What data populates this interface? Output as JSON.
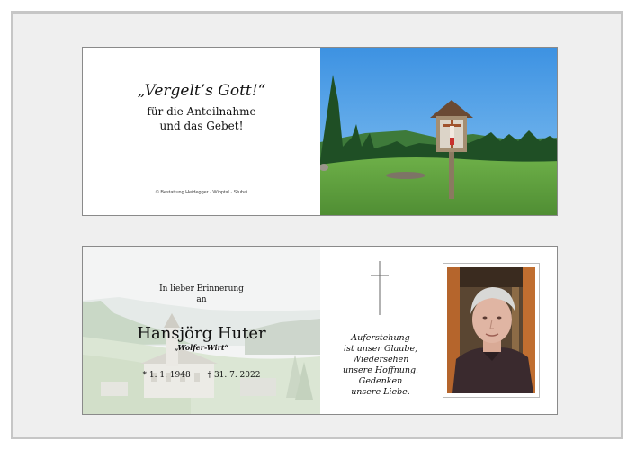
{
  "card_front": {
    "title": "„Vergelt’s Gott!“",
    "line1": "für die Anteilnahme",
    "line2": "und das Gebet!",
    "credit": "© Bestattung Heidegger · Wipptal · Stubai"
  },
  "card_memorial": {
    "intro_line1": "In lieber Erinnerung",
    "intro_line2": "an",
    "name": "Hansjörg Huter",
    "nickname": "„Wolfer-Wirt“",
    "birth": "* 1. 1. 1948",
    "death": "† 31. 7. 2022",
    "quote": [
      "Auferstehung",
      "ist unser Glaube,",
      "Wiedersehen",
      "unsere Hoffnung.",
      "Gedenken",
      "unsere Liebe."
    ]
  },
  "colors": {
    "frame_bg": "#efefef",
    "frame_border": "#c6c6c6",
    "sky": "#4f9fe6",
    "meadow": "#6fb04a"
  }
}
